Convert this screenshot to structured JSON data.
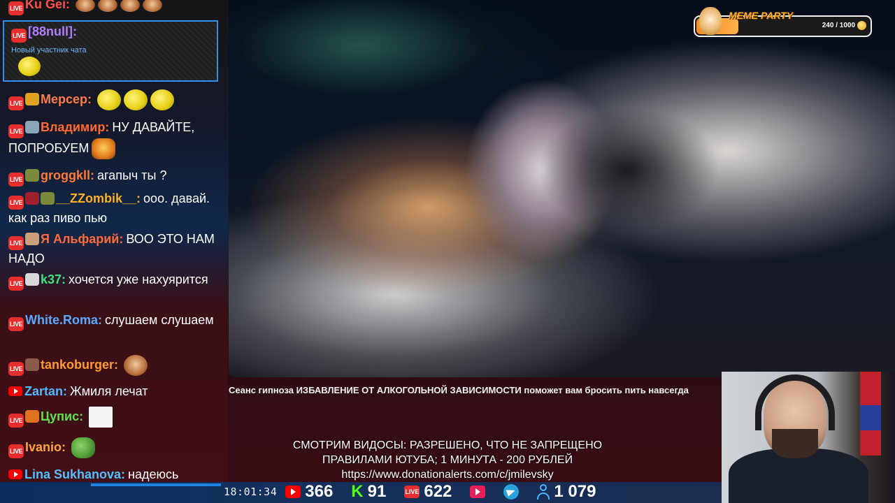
{
  "chat": {
    "messages": [
      {
        "user": "Ku Gei:",
        "color": "#ff4f4f",
        "text": ""
      },
      {
        "user": "Мерсер:",
        "color": "#ff7a4a",
        "text": ""
      },
      {
        "user": "Владимир:",
        "color": "#ff6a2e",
        "text": "НУ ДАВАЙТЕ, ПОПРОБУЕМ"
      },
      {
        "user": "groggkll:",
        "color": "#ff7a35",
        "text": "агапыч ты ?"
      },
      {
        "user": "__ZZombik__:",
        "color": "#ffb020",
        "text": "ооо. давай. как раз пиво пью"
      },
      {
        "user": "Я Альфарий:",
        "color": "#ff6a3a",
        "text": "ВОО ЭТО НАМ НАДО"
      },
      {
        "user": "k37:",
        "color": "#40e080",
        "text": "хочется уже нахуярится"
      },
      {
        "user": "White.Roma:",
        "color": "#5aa8ff",
        "text": "слушаем слушаем"
      },
      {
        "user": "tankoburger:",
        "color": "#ff9a2e",
        "text": ""
      },
      {
        "user": "Zartan:",
        "color": "#52b8ff",
        "text": "Жмиля лечат"
      },
      {
        "user": "Цупис:",
        "color": "#5fe04a",
        "text": ""
      },
      {
        "user": "Ivanio:",
        "color": "#ffa53a",
        "text": ""
      },
      {
        "user": "Lina Sukhanova:",
        "color": "#52c0ff",
        "text": "надеюсь поможет"
      }
    ],
    "highlight": {
      "user": "[88null]:",
      "note": "Новый участник чата",
      "border_color": "#2e8ff0"
    },
    "live_badge": "LIVE"
  },
  "video": {
    "title_prefix": "Сеанс гипноза",
    "title_rest": "ИЗБАВЛЕНИЕ ОТ АЛКОГОЛЬНОЙ ЗАВИСИМОСТИ поможет вам бросить пить навсегда"
  },
  "meme_party": {
    "title": "MEME PARTY",
    "progress": "240 / 1000"
  },
  "announcement": {
    "line1": "СМОТРИМ ВИДОСЫ: РАЗРЕШЕНО, ЧТО НЕ ЗАПРЕЩЕНО",
    "line2": "ПРАВИЛАМИ ЮТУБА; 1 МИНУТА - 200 РУБЛЕЙ",
    "line3": "https://www.donationalerts.com/c/jmilevsky"
  },
  "stats": {
    "time": "18:01:34",
    "youtube": "366",
    "kick": "91",
    "kick_icon": "K",
    "live": "622",
    "total": "1 079"
  },
  "icons": {
    "youtube": "youtube-icon",
    "kick": "kick-icon",
    "live": "live-icon",
    "vk": "vk-video-icon",
    "telegram": "telegram-icon",
    "viewers": "user-icon"
  }
}
